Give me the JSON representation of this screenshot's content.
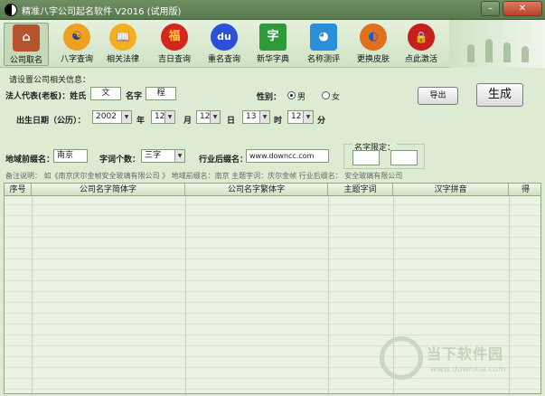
{
  "window": {
    "title": "精准八字公司起名软件 V2016 (试用版)",
    "minimize_label": "–",
    "close_label": "✕"
  },
  "toolbar": {
    "items": [
      {
        "label": "公司取名",
        "icon": "house-icon",
        "glyph": "⌂",
        "color": "#b5542f"
      },
      {
        "label": "八字查询",
        "icon": "yin-yang-icon",
        "glyph": "☯",
        "color": "#2a55b8"
      },
      {
        "label": "相关法律",
        "icon": "book-icon",
        "glyph": "📖",
        "color": "#f0b020"
      },
      {
        "label": "吉日查询",
        "icon": "lantern-icon",
        "glyph": "福",
        "color": "#d4261c"
      },
      {
        "label": "重名查询",
        "icon": "baidu-icon",
        "glyph": "du",
        "color": "#2b4fd6"
      },
      {
        "label": "新华字典",
        "icon": "dictionary-icon",
        "glyph": "字",
        "color": "#2f9a3a"
      },
      {
        "label": "名称测评",
        "icon": "doraemon-icon",
        "glyph": "◕",
        "color": "#2a8ed8"
      },
      {
        "label": "更换皮肤",
        "icon": "palette-icon",
        "glyph": "◐",
        "color": "#e0701c"
      },
      {
        "label": "点此激活",
        "icon": "lock-icon",
        "glyph": "🔒",
        "color": "#c81e1e"
      }
    ]
  },
  "form": {
    "section_title": "请设置公司相关信息：",
    "legal_rep_label": "法人代表(老板)：姓氏",
    "surname_value": "文",
    "given_name_label": "名字",
    "given_name_value": "程",
    "gender_label": "性别：",
    "gender_male": "男",
    "gender_female": "女",
    "export_button": "导出",
    "generate_button": "生成",
    "birth_label": "出生日期（公历）：",
    "year_value": "2002",
    "year_unit": "年",
    "month_value": "12",
    "month_unit": "月",
    "day_value": "12",
    "day_unit": "日",
    "hour_value": "13",
    "hour_unit": "时",
    "minute_value": "12",
    "minute_unit": "分",
    "region_label": "地域前缀名：",
    "region_value": "南京",
    "word_count_label": "字词个数：",
    "word_count_value": "三字",
    "industry_label": "行业后缀名：",
    "industry_value": "www.downcc.com",
    "name_limit_label": "名字限定：",
    "note": "备注说明：  如《南京庆尔金帧安全玻璃有限公司 》 地域前缀名：南京        主题字词：庆尔金帧           行业后缀名：   安全玻璃有限公司"
  },
  "table": {
    "columns": [
      "序号",
      "公司名字简体字",
      "公司名字繁体字",
      "主题字词",
      "汉字拼音",
      "得"
    ]
  },
  "watermark": {
    "brand": "当下软件园",
    "url": "www.downxia.com"
  }
}
